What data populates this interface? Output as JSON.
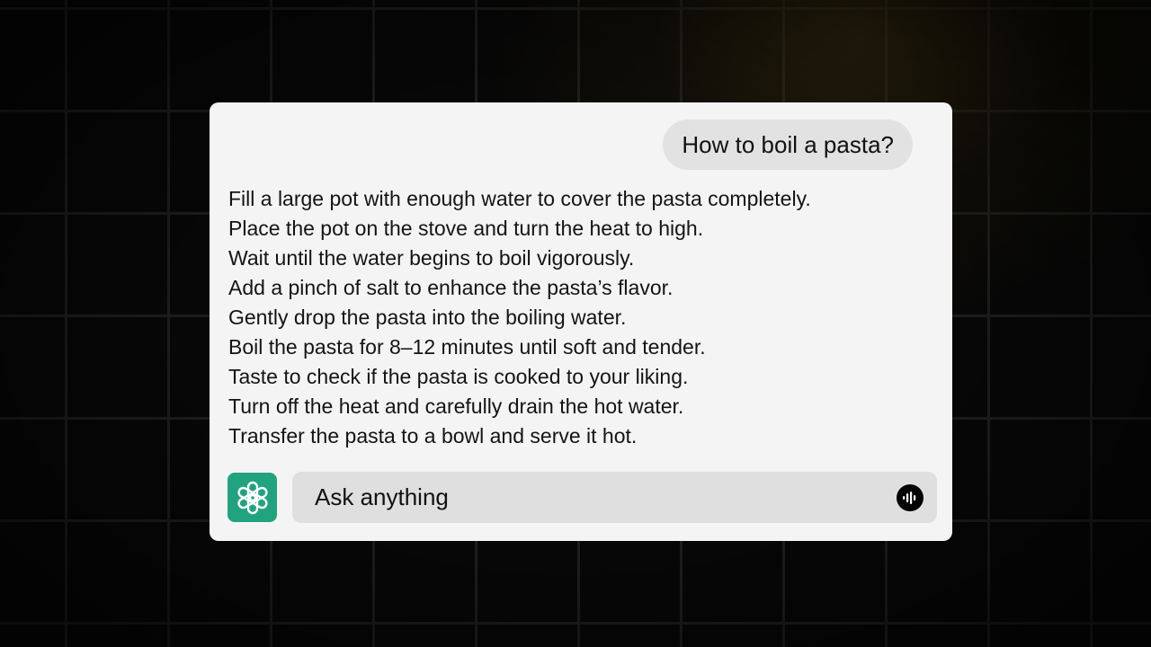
{
  "chat": {
    "user_message": "How to boil a pasta?",
    "response_lines": [
      "Fill a large pot with enough water to cover the pasta completely.",
      "Place the pot on the stove and turn the heat to high.",
      "Wait until the water begins to boil vigorously.",
      "Add a pinch of salt to enhance the pasta’s flavor.",
      "Gently drop the pasta into the boiling water.",
      "Boil the pasta for 8–12 minutes until soft and tender.",
      "Taste to check if the pasta is cooked to your liking.",
      "Turn off the heat and carefully drain the hot water.",
      "Transfer the pasta to a bowl and serve it hot."
    ]
  },
  "composer": {
    "placeholder": "Ask anything",
    "logo_icon": "openai-logo-icon",
    "voice_icon": "voice-waveform-icon"
  },
  "colors": {
    "card_background": "#f4f4f4",
    "user_bubble": "#e2e2e2",
    "input_background": "#dfdfdf",
    "logo_green": "#22a37f",
    "page_background": "#070707"
  }
}
